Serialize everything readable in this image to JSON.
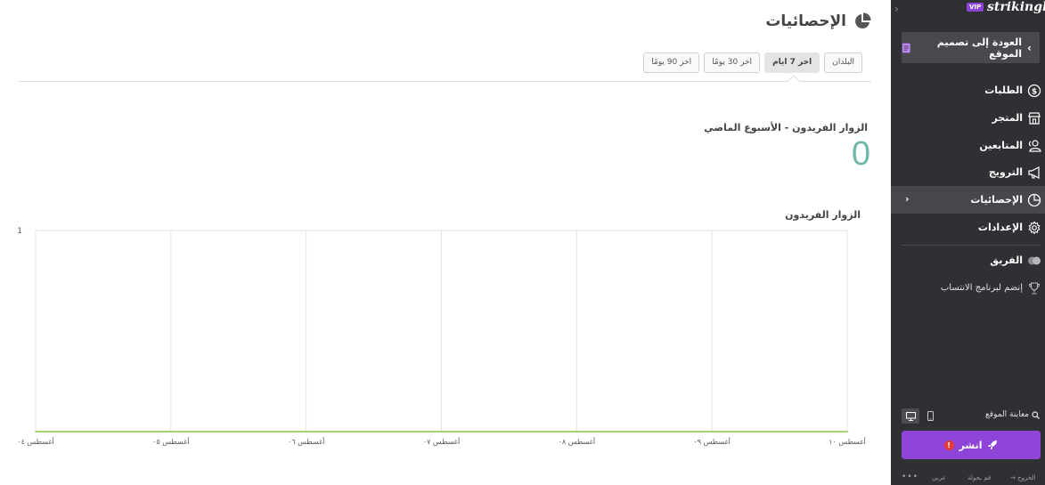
{
  "page": {
    "title": "الإحصائيات",
    "tabs": [
      {
        "label": "البلدان",
        "active": false
      },
      {
        "label": "اخر 7 ايام",
        "active": true
      },
      {
        "label": "اخر 30 يومًا",
        "active": false
      },
      {
        "label": "اخر 90 يومًا",
        "active": false
      }
    ],
    "visitors_label": "الزوار الفريدون - الأسبوع الماضي",
    "visitors_count": "0"
  },
  "chart_data": {
    "type": "line",
    "title": "الزوار الفريدون",
    "x": [
      "أغسطس ٠٤",
      "أغسطس ٠٥",
      "أغسطس ٠٦",
      "أغسطس ٠٧",
      "أغسطس ٠٨",
      "أغسطس ٠٩",
      "أغسطس ١٠"
    ],
    "series": [
      {
        "values": [
          0,
          0,
          0,
          0,
          0,
          0,
          0
        ],
        "color": "#8bc34a"
      }
    ],
    "ylim": [
      0,
      1
    ],
    "yticks": [
      "1"
    ],
    "grid": true
  },
  "sidebar": {
    "brand": "strikingly",
    "vip": "VIP",
    "collapse_glyph": "›",
    "back_label": "العودة إلى تصميم الموقع",
    "items": [
      {
        "label": "الطلبات",
        "icon": "dollar-circle-icon"
      },
      {
        "label": "المتجر",
        "icon": "store-icon"
      },
      {
        "label": "المتابعين",
        "icon": "users-icon"
      },
      {
        "label": "الترويج",
        "icon": "megaphone-icon"
      },
      {
        "label": "الإحصائيات",
        "icon": "pie-chart-icon",
        "active": true
      },
      {
        "label": "الإعدادات",
        "icon": "gear-icon"
      },
      {
        "label": "الفريق",
        "icon": "team-icon"
      },
      {
        "label": "إنضم لبرنامج الانتساب",
        "icon": "trophy-icon"
      }
    ],
    "preview_label": "معاينة الموقع",
    "publish_label": "انشر",
    "publish_warning": "!",
    "footer": {
      "more": "•••",
      "language": "عربي",
      "tour": "قم بجولة",
      "logout": "الخروج"
    }
  },
  "colors": {
    "sidebar_bg": "#2e3033",
    "accent": "#8e44d6",
    "count": "#6fb7a8",
    "line": "#8bc34a"
  }
}
